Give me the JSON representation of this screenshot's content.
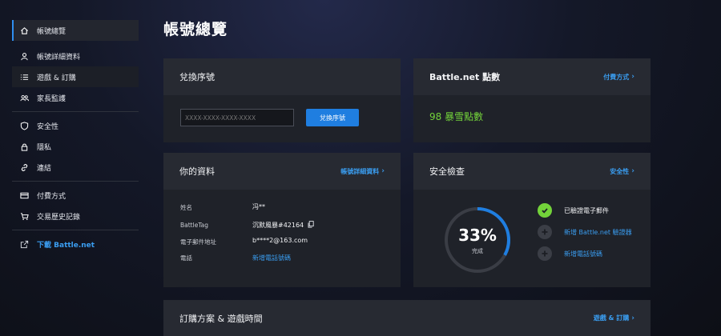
{
  "sidebar": {
    "items": [
      {
        "label": "帳號總覽",
        "icon": "home-icon"
      },
      {
        "label": "帳號詳細資料",
        "icon": "user-icon"
      },
      {
        "label": "遊戲 & 訂購",
        "icon": "list-icon"
      },
      {
        "label": "家長監護",
        "icon": "users-icon"
      },
      {
        "label": "安全性",
        "icon": "shield-icon"
      },
      {
        "label": "隱私",
        "icon": "lock-icon"
      },
      {
        "label": "連結",
        "icon": "link-icon"
      },
      {
        "label": "付費方式",
        "icon": "credit-card-icon"
      },
      {
        "label": "交易歷史記錄",
        "icon": "cart-icon"
      },
      {
        "label": "下載 Battle.net",
        "icon": "external-link-icon"
      }
    ]
  },
  "page": {
    "title": "帳號總覽"
  },
  "redeem": {
    "title": "兌換序號",
    "placeholder": "XXXX-XXXX-XXXX-XXXX",
    "button": "兌換序號"
  },
  "balance": {
    "title": "Battle.net 點數",
    "link": "付費方式",
    "points": "98 暴雪點數"
  },
  "profile": {
    "title": "你的資料",
    "link": "帳號詳細資料",
    "rows": [
      {
        "label": "姓名",
        "value": "冯**"
      },
      {
        "label": "BattleTag",
        "value": "沉默風暴#42164"
      },
      {
        "label": "電子郵件地址",
        "value": "b****2@163.com"
      },
      {
        "label": "電話",
        "value": "新增電話號碼"
      }
    ]
  },
  "security": {
    "title": "安全檢查",
    "link": "安全性",
    "percent": "33%",
    "percent_value": 33,
    "percent_label": "完成",
    "items": [
      {
        "label": "已驗證電子郵件",
        "done": true
      },
      {
        "label": "新增 Battle.net 驗證器",
        "done": false
      },
      {
        "label": "新增電話號碼",
        "done": false
      }
    ]
  },
  "subscriptions": {
    "title": "訂購方案 & 遊戲時間",
    "link": "遊戲 & 訂購"
  },
  "colors": {
    "accent": "#2f8ff0",
    "success": "#73d33a",
    "card": "#1f2229"
  }
}
